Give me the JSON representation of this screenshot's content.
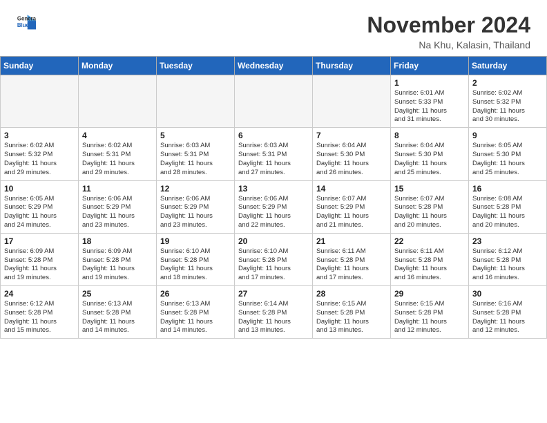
{
  "header": {
    "logo_line1": "General",
    "logo_line2": "Blue",
    "month": "November 2024",
    "location": "Na Khu, Kalasin, Thailand"
  },
  "weekdays": [
    "Sunday",
    "Monday",
    "Tuesday",
    "Wednesday",
    "Thursday",
    "Friday",
    "Saturday"
  ],
  "weeks": [
    [
      {
        "day": "",
        "info": ""
      },
      {
        "day": "",
        "info": ""
      },
      {
        "day": "",
        "info": ""
      },
      {
        "day": "",
        "info": ""
      },
      {
        "day": "",
        "info": ""
      },
      {
        "day": "1",
        "info": "Sunrise: 6:01 AM\nSunset: 5:33 PM\nDaylight: 11 hours\nand 31 minutes."
      },
      {
        "day": "2",
        "info": "Sunrise: 6:02 AM\nSunset: 5:32 PM\nDaylight: 11 hours\nand 30 minutes."
      }
    ],
    [
      {
        "day": "3",
        "info": "Sunrise: 6:02 AM\nSunset: 5:32 PM\nDaylight: 11 hours\nand 29 minutes."
      },
      {
        "day": "4",
        "info": "Sunrise: 6:02 AM\nSunset: 5:31 PM\nDaylight: 11 hours\nand 29 minutes."
      },
      {
        "day": "5",
        "info": "Sunrise: 6:03 AM\nSunset: 5:31 PM\nDaylight: 11 hours\nand 28 minutes."
      },
      {
        "day": "6",
        "info": "Sunrise: 6:03 AM\nSunset: 5:31 PM\nDaylight: 11 hours\nand 27 minutes."
      },
      {
        "day": "7",
        "info": "Sunrise: 6:04 AM\nSunset: 5:30 PM\nDaylight: 11 hours\nand 26 minutes."
      },
      {
        "day": "8",
        "info": "Sunrise: 6:04 AM\nSunset: 5:30 PM\nDaylight: 11 hours\nand 25 minutes."
      },
      {
        "day": "9",
        "info": "Sunrise: 6:05 AM\nSunset: 5:30 PM\nDaylight: 11 hours\nand 25 minutes."
      }
    ],
    [
      {
        "day": "10",
        "info": "Sunrise: 6:05 AM\nSunset: 5:29 PM\nDaylight: 11 hours\nand 24 minutes."
      },
      {
        "day": "11",
        "info": "Sunrise: 6:06 AM\nSunset: 5:29 PM\nDaylight: 11 hours\nand 23 minutes."
      },
      {
        "day": "12",
        "info": "Sunrise: 6:06 AM\nSunset: 5:29 PM\nDaylight: 11 hours\nand 23 minutes."
      },
      {
        "day": "13",
        "info": "Sunrise: 6:06 AM\nSunset: 5:29 PM\nDaylight: 11 hours\nand 22 minutes."
      },
      {
        "day": "14",
        "info": "Sunrise: 6:07 AM\nSunset: 5:29 PM\nDaylight: 11 hours\nand 21 minutes."
      },
      {
        "day": "15",
        "info": "Sunrise: 6:07 AM\nSunset: 5:28 PM\nDaylight: 11 hours\nand 20 minutes."
      },
      {
        "day": "16",
        "info": "Sunrise: 6:08 AM\nSunset: 5:28 PM\nDaylight: 11 hours\nand 20 minutes."
      }
    ],
    [
      {
        "day": "17",
        "info": "Sunrise: 6:09 AM\nSunset: 5:28 PM\nDaylight: 11 hours\nand 19 minutes."
      },
      {
        "day": "18",
        "info": "Sunrise: 6:09 AM\nSunset: 5:28 PM\nDaylight: 11 hours\nand 19 minutes."
      },
      {
        "day": "19",
        "info": "Sunrise: 6:10 AM\nSunset: 5:28 PM\nDaylight: 11 hours\nand 18 minutes."
      },
      {
        "day": "20",
        "info": "Sunrise: 6:10 AM\nSunset: 5:28 PM\nDaylight: 11 hours\nand 17 minutes."
      },
      {
        "day": "21",
        "info": "Sunrise: 6:11 AM\nSunset: 5:28 PM\nDaylight: 11 hours\nand 17 minutes."
      },
      {
        "day": "22",
        "info": "Sunrise: 6:11 AM\nSunset: 5:28 PM\nDaylight: 11 hours\nand 16 minutes."
      },
      {
        "day": "23",
        "info": "Sunrise: 6:12 AM\nSunset: 5:28 PM\nDaylight: 11 hours\nand 16 minutes."
      }
    ],
    [
      {
        "day": "24",
        "info": "Sunrise: 6:12 AM\nSunset: 5:28 PM\nDaylight: 11 hours\nand 15 minutes."
      },
      {
        "day": "25",
        "info": "Sunrise: 6:13 AM\nSunset: 5:28 PM\nDaylight: 11 hours\nand 14 minutes."
      },
      {
        "day": "26",
        "info": "Sunrise: 6:13 AM\nSunset: 5:28 PM\nDaylight: 11 hours\nand 14 minutes."
      },
      {
        "day": "27",
        "info": "Sunrise: 6:14 AM\nSunset: 5:28 PM\nDaylight: 11 hours\nand 13 minutes."
      },
      {
        "day": "28",
        "info": "Sunrise: 6:15 AM\nSunset: 5:28 PM\nDaylight: 11 hours\nand 13 minutes."
      },
      {
        "day": "29",
        "info": "Sunrise: 6:15 AM\nSunset: 5:28 PM\nDaylight: 11 hours\nand 12 minutes."
      },
      {
        "day": "30",
        "info": "Sunrise: 6:16 AM\nSunset: 5:28 PM\nDaylight: 11 hours\nand 12 minutes."
      }
    ]
  ]
}
